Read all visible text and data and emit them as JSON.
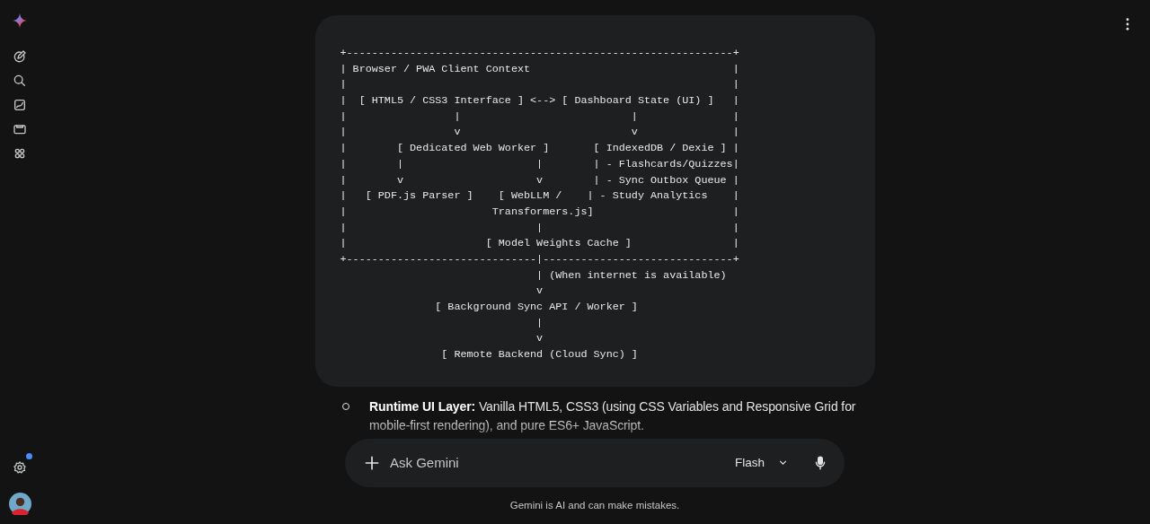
{
  "code_block": {
    "lines": [
      "+-------------------------------------------------------------+",
      "| Browser / PWA Client Context                                |",
      "|                                                             |",
      "|  [ HTML5 / CSS3 Interface ] <--> [ Dashboard State (UI) ]   |",
      "|                 |                           |               |",
      "|                 v                           v               |",
      "|        [ Dedicated Web Worker ]       [ IndexedDB / Dexie ] |",
      "|        |                     |        | - Flashcards/Quizzes|",
      "|        v                     v        | - Sync Outbox Queue |",
      "|   [ PDF.js Parser ]    [ WebLLM /    | - Study Analytics    |",
      "|                       Transformers.js]                      |",
      "|                              |                              |",
      "|                      [ Model Weights Cache ]                |",
      "+------------------------------|------------------------------+",
      "                               | (When internet is available)",
      "                               v",
      "               [ Background Sync API / Worker ]",
      "                               |",
      "                               v",
      "                [ Remote Backend (Cloud Sync) ]"
    ]
  },
  "list_items": [
    {
      "text": "**Runtime UI Layer:** Vanilla HTML5, CSS3 (using CSS Variables and Responsive Grid for mobile-first rendering), and pure ES6+ JavaScript."
    }
  ],
  "composer": {
    "placeholder": "Ask Gemini",
    "model": "Flash"
  },
  "disclaimer": "Gemini is AI and can make mistakes.",
  "settings": {
    "notification": true
  }
}
